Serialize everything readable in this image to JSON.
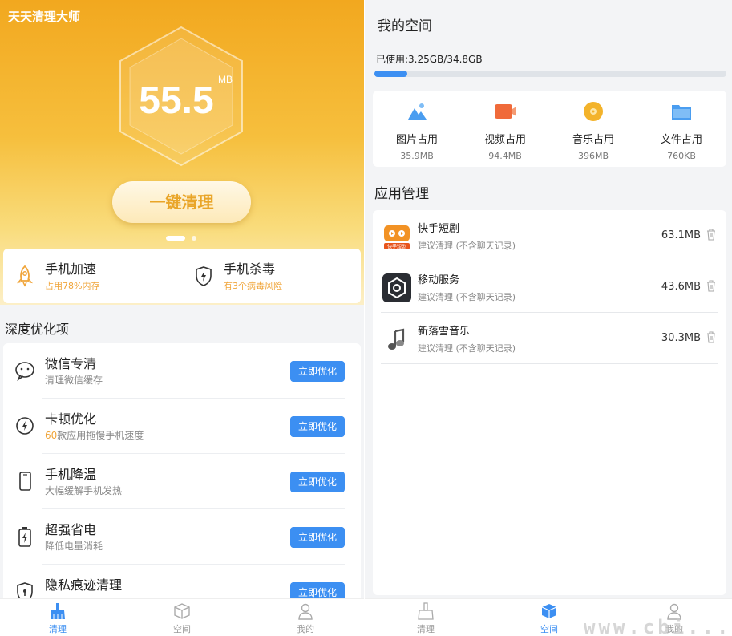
{
  "left": {
    "app_title": "天天清理大师",
    "junk_value": "55.5",
    "junk_unit": "MB",
    "clean_button": "一键清理",
    "quick_actions": [
      {
        "title": "手机加速",
        "subtitle": "占用78%内存",
        "icon": "rocket-icon"
      },
      {
        "title": "手机杀毒",
        "subtitle": "有3个病毒风险",
        "icon": "shield-icon"
      }
    ],
    "section_title": "深度优化项",
    "optimizations": [
      {
        "title": "微信专清",
        "subtitle": "清理微信缓存",
        "button": "立即优化",
        "icon": "wechat-icon"
      },
      {
        "title": "卡顿优化",
        "highlight": "60",
        "subtitle": "款应用拖慢手机速度",
        "button": "立即优化",
        "icon": "speed-icon"
      },
      {
        "title": "手机降温",
        "subtitle": "大幅缓解手机发热",
        "button": "立即优化",
        "icon": "phone-icon"
      },
      {
        "title": "超强省电",
        "subtitle": "降低电量消耗",
        "button": "立即优化",
        "icon": "battery-icon"
      },
      {
        "title": "隐私痕迹清理",
        "subtitle": "",
        "button": "立即优化",
        "icon": "privacy-icon"
      }
    ],
    "tabs": [
      {
        "label": "清理",
        "icon": "broom-icon",
        "active": true
      },
      {
        "label": "空间",
        "icon": "box-icon",
        "active": false
      },
      {
        "label": "我的",
        "icon": "user-icon",
        "active": false
      }
    ]
  },
  "right": {
    "title": "我的空间",
    "used_text": "已使用:3.25GB/34.8GB",
    "used_fraction": 0.093,
    "storage": [
      {
        "label": "图片占用",
        "value": "35.9MB",
        "icon": "image-icon",
        "color": "#4a9df0"
      },
      {
        "label": "视频占用",
        "value": "94.4MB",
        "icon": "video-icon",
        "color": "#f06a3a"
      },
      {
        "label": "音乐占用",
        "value": "396MB",
        "icon": "music-disc-icon",
        "color": "#f3b32b"
      },
      {
        "label": "文件占用",
        "value": "760KB",
        "icon": "folder-icon",
        "color": "#4a9df0"
      }
    ],
    "app_mgmt_title": "应用管理",
    "apps": [
      {
        "name": "快手短剧",
        "hint": "建议清理 (不含聊天记录)",
        "size": "63.1MB",
        "icon": "kuaishou-icon",
        "badge": "快手短剧"
      },
      {
        "name": "移动服务",
        "hint": "建议清理 (不含聊天记录)",
        "size": "43.6MB",
        "icon": "mobile-service-icon"
      },
      {
        "name": "新落雪音乐",
        "hint": "建议清理 (不含聊天记录)",
        "size": "30.3MB",
        "icon": "music-note-icon"
      }
    ],
    "tabs": [
      {
        "label": "清理",
        "icon": "broom-icon",
        "active": false
      },
      {
        "label": "空间",
        "icon": "box-icon",
        "active": true
      },
      {
        "label": "我的",
        "icon": "user-icon",
        "active": false
      }
    ]
  },
  "watermark": "www.cbi..."
}
